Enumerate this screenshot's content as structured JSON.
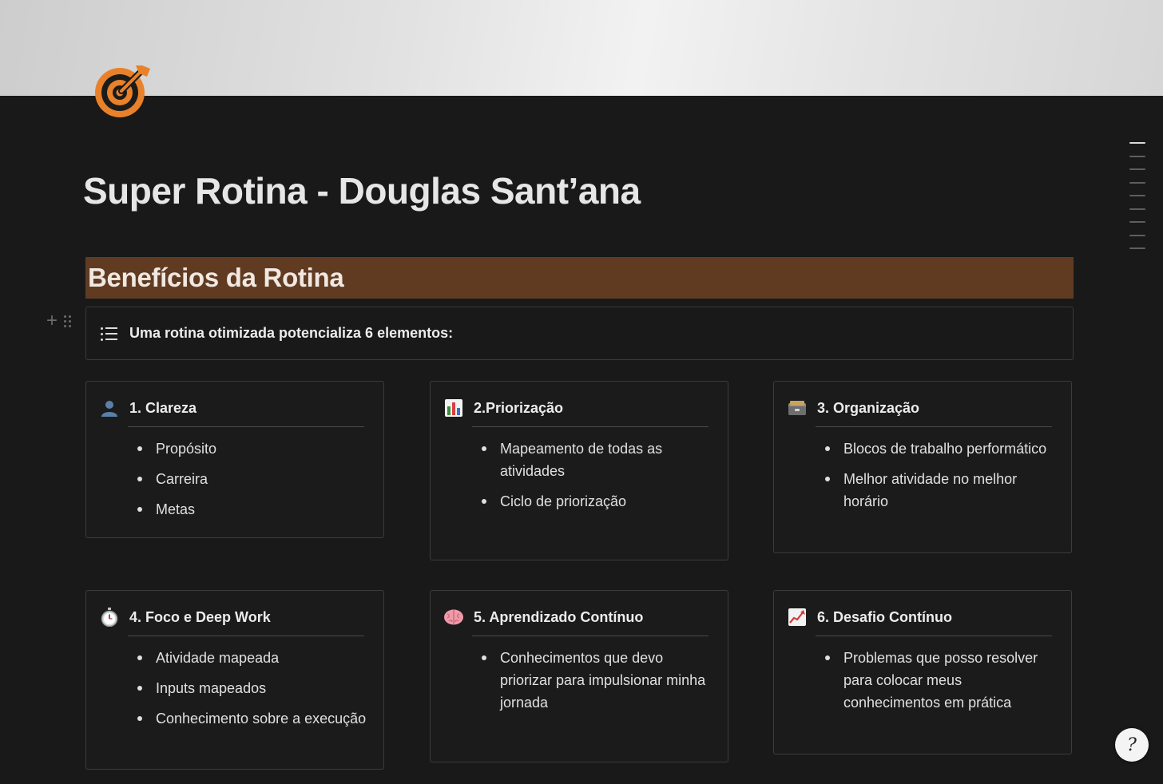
{
  "page": {
    "title": "Super Rotina - Douglas Sant’ana",
    "icon": "target-icon",
    "cover_color": "#e8e8e8"
  },
  "section": {
    "heading": "Benefícios da Rotina",
    "heading_bg": "#603b22"
  },
  "callout": {
    "icon": "list-icon",
    "text": "Uma rotina otimizada potencializa 6 elementos:"
  },
  "cards": [
    {
      "icon": "person-silhouette-icon",
      "title": "1. Clareza",
      "items": [
        "Propósito",
        "Carreira",
        "Metas"
      ]
    },
    {
      "icon": "bar-chart-icon",
      "title": "2.Priorização",
      "items": [
        "Mapeamento de todas as atividades",
        "Ciclo de priorização"
      ]
    },
    {
      "icon": "card-file-box-icon",
      "title": "3. Organização",
      "items": [
        "Blocos de trabalho performático",
        "Melhor atividade no melhor horário"
      ]
    },
    {
      "icon": "stopwatch-icon",
      "title": "4. Foco e Deep Work",
      "items": [
        "Atividade mapeada",
        "Inputs mapeados",
        "Conhecimento sobre a execução"
      ]
    },
    {
      "icon": "brain-icon",
      "title": "5. Aprendizado Contínuo",
      "items": [
        "Conhecimentos que devo priorizar para impulsionar minha jornada"
      ]
    },
    {
      "icon": "chart-increasing-icon",
      "title": "6. Desafio Contínuo",
      "items": [
        "Problemas que posso resolver para colocar meus conhecimentos em prática"
      ]
    }
  ],
  "toc": {
    "entries": 9,
    "active_index": 0
  },
  "help": {
    "glyph": "?"
  }
}
